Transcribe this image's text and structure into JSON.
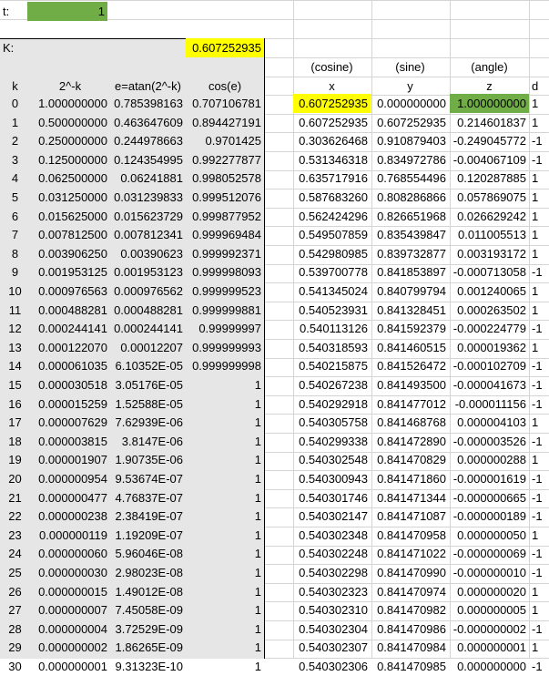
{
  "t_label": "t:",
  "t_value": "1",
  "k_label": "K:",
  "k_value": "0.607252935",
  "colors": {
    "green": "#70ad47",
    "yellow": "#ffff00",
    "gray": "#e7e6e6",
    "grid": "#d4d4d4"
  },
  "group_headers": {
    "cosine": "(cosine)",
    "sine": "(sine)",
    "angle": "(angle)"
  },
  "column_headers": [
    "k",
    "2^-k",
    "e=atan(2^-k)",
    "cos(e)",
    "x",
    "y",
    "z",
    "d"
  ],
  "rows": [
    [
      "0",
      "1.000000000",
      "0.785398163",
      "0.707106781",
      "0.607252935",
      "0.000000000",
      "1.000000000",
      "1"
    ],
    [
      "1",
      "0.500000000",
      "0.463647609",
      "0.894427191",
      "0.607252935",
      "0.607252935",
      "0.214601837",
      "1"
    ],
    [
      "2",
      "0.250000000",
      "0.244978663",
      "0.9701425",
      "0.303626468",
      "0.910879403",
      "-0.249045772",
      "-1"
    ],
    [
      "3",
      "0.125000000",
      "0.124354995",
      "0.992277877",
      "0.531346318",
      "0.834972786",
      "-0.004067109",
      "-1"
    ],
    [
      "4",
      "0.062500000",
      "0.06241881",
      "0.998052578",
      "0.635717916",
      "0.768554496",
      "0.120287885",
      "1"
    ],
    [
      "5",
      "0.031250000",
      "0.031239833",
      "0.999512076",
      "0.587683260",
      "0.808286866",
      "0.057869075",
      "1"
    ],
    [
      "6",
      "0.015625000",
      "0.015623729",
      "0.999877952",
      "0.562424296",
      "0.826651968",
      "0.026629242",
      "1"
    ],
    [
      "7",
      "0.007812500",
      "0.007812341",
      "0.999969484",
      "0.549507859",
      "0.835439847",
      "0.011005513",
      "1"
    ],
    [
      "8",
      "0.003906250",
      "0.00390623",
      "0.999992371",
      "0.542980985",
      "0.839732877",
      "0.003193172",
      "1"
    ],
    [
      "9",
      "0.001953125",
      "0.001953123",
      "0.999998093",
      "0.539700778",
      "0.841853897",
      "-0.000713058",
      "-1"
    ],
    [
      "10",
      "0.000976563",
      "0.000976562",
      "0.999999523",
      "0.541345024",
      "0.840799794",
      "0.001240065",
      "1"
    ],
    [
      "11",
      "0.000488281",
      "0.000488281",
      "0.999999881",
      "0.540523931",
      "0.841328451",
      "0.000263502",
      "1"
    ],
    [
      "12",
      "0.000244141",
      "0.000244141",
      "0.99999997",
      "0.540113126",
      "0.841592379",
      "-0.000224779",
      "-1"
    ],
    [
      "13",
      "0.000122070",
      "0.00012207",
      "0.999999993",
      "0.540318593",
      "0.841460515",
      "0.000019362",
      "1"
    ],
    [
      "14",
      "0.000061035",
      "6.10352E-05",
      "0.999999998",
      "0.540215875",
      "0.841526472",
      "-0.000102709",
      "-1"
    ],
    [
      "15",
      "0.000030518",
      "3.05176E-05",
      "1",
      "0.540267238",
      "0.841493500",
      "-0.000041673",
      "-1"
    ],
    [
      "16",
      "0.000015259",
      "1.52588E-05",
      "1",
      "0.540292918",
      "0.841477012",
      "-0.000011156",
      "-1"
    ],
    [
      "17",
      "0.000007629",
      "7.62939E-06",
      "1",
      "0.540305758",
      "0.841468768",
      "0.000004103",
      "1"
    ],
    [
      "18",
      "0.000003815",
      "3.8147E-06",
      "1",
      "0.540299338",
      "0.841472890",
      "-0.000003526",
      "-1"
    ],
    [
      "19",
      "0.000001907",
      "1.90735E-06",
      "1",
      "0.540302548",
      "0.841470829",
      "0.000000288",
      "1"
    ],
    [
      "20",
      "0.000000954",
      "9.53674E-07",
      "1",
      "0.540300943",
      "0.841471860",
      "-0.000001619",
      "-1"
    ],
    [
      "21",
      "0.000000477",
      "4.76837E-07",
      "1",
      "0.540301746",
      "0.841471344",
      "-0.000000665",
      "-1"
    ],
    [
      "22",
      "0.000000238",
      "2.38419E-07",
      "1",
      "0.540302147",
      "0.841471087",
      "-0.000000189",
      "-1"
    ],
    [
      "23",
      "0.000000119",
      "1.19209E-07",
      "1",
      "0.540302348",
      "0.841470958",
      "0.000000050",
      "1"
    ],
    [
      "24",
      "0.000000060",
      "5.96046E-08",
      "1",
      "0.540302248",
      "0.841471022",
      "-0.000000069",
      "-1"
    ],
    [
      "25",
      "0.000000030",
      "2.98023E-08",
      "1",
      "0.540302298",
      "0.841470990",
      "-0.000000010",
      "-1"
    ],
    [
      "26",
      "0.000000015",
      "1.49012E-08",
      "1",
      "0.540302323",
      "0.841470974",
      "0.000000020",
      "1"
    ],
    [
      "27",
      "0.000000007",
      "7.45058E-09",
      "1",
      "0.540302310",
      "0.841470982",
      "0.000000005",
      "1"
    ],
    [
      "28",
      "0.000000004",
      "3.72529E-09",
      "1",
      "0.540302304",
      "0.841470986",
      "-0.000000002",
      "-1"
    ],
    [
      "29",
      "0.000000002",
      "1.86265E-09",
      "1",
      "0.540302307",
      "0.841470984",
      "0.000000001",
      "1"
    ],
    [
      "30",
      "0.000000001",
      "9.31323E-10",
      "1",
      "0.540302306",
      "0.841470985",
      "0.000000000",
      "-1"
    ]
  ]
}
